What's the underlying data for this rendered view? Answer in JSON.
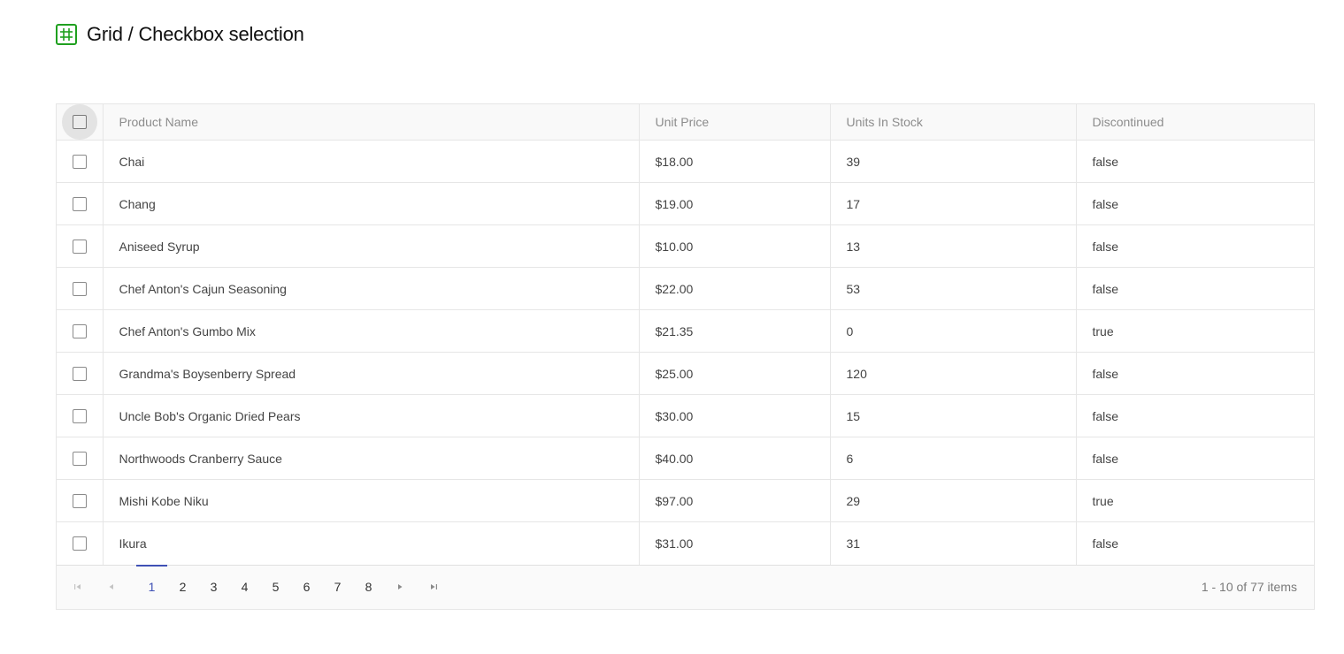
{
  "page": {
    "title": "Grid / Checkbox selection",
    "icon": "grid-icon"
  },
  "grid": {
    "columns": {
      "select_all": "",
      "product_name": "Product Name",
      "unit_price": "Unit Price",
      "units_in_stock": "Units In Stock",
      "discontinued": "Discontinued"
    },
    "rows": [
      {
        "product_name": "Chai",
        "unit_price": "$18.00",
        "units_in_stock": "39",
        "discontinued": "false",
        "selected": false
      },
      {
        "product_name": "Chang",
        "unit_price": "$19.00",
        "units_in_stock": "17",
        "discontinued": "false",
        "selected": false
      },
      {
        "product_name": "Aniseed Syrup",
        "unit_price": "$10.00",
        "units_in_stock": "13",
        "discontinued": "false",
        "selected": false
      },
      {
        "product_name": "Chef Anton's Cajun Seasoning",
        "unit_price": "$22.00",
        "units_in_stock": "53",
        "discontinued": "false",
        "selected": false
      },
      {
        "product_name": "Chef Anton's Gumbo Mix",
        "unit_price": "$21.35",
        "units_in_stock": "0",
        "discontinued": "true",
        "selected": false
      },
      {
        "product_name": "Grandma's Boysenberry Spread",
        "unit_price": "$25.00",
        "units_in_stock": "120",
        "discontinued": "false",
        "selected": false
      },
      {
        "product_name": "Uncle Bob's Organic Dried Pears",
        "unit_price": "$30.00",
        "units_in_stock": "15",
        "discontinued": "false",
        "selected": false
      },
      {
        "product_name": "Northwoods Cranberry Sauce",
        "unit_price": "$40.00",
        "units_in_stock": "6",
        "discontinued": "false",
        "selected": false
      },
      {
        "product_name": "Mishi Kobe Niku",
        "unit_price": "$97.00",
        "units_in_stock": "29",
        "discontinued": "true",
        "selected": false
      },
      {
        "product_name": "Ikura",
        "unit_price": "$31.00",
        "units_in_stock": "31",
        "discontinued": "false",
        "selected": false
      }
    ]
  },
  "pager": {
    "pages": [
      "1",
      "2",
      "3",
      "4",
      "5",
      "6",
      "7",
      "8"
    ],
    "current_page": "1",
    "info": "1 - 10 of 77 items",
    "icons": {
      "first": "first-page-icon",
      "prev": "previous-page-icon",
      "next": "next-page-icon",
      "last": "last-page-icon"
    }
  },
  "colors": {
    "accent": "#3f51b5",
    "icon_green": "#1fa01f",
    "border": "#e6e6e6",
    "header_text": "#8c8c8c"
  }
}
